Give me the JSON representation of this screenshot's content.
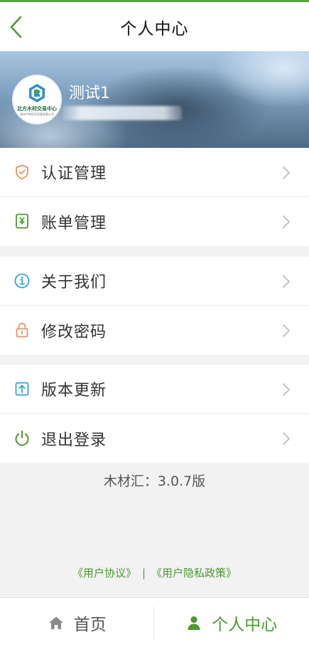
{
  "header": {
    "title": "个人中心",
    "back_icon": "chevron-left-icon"
  },
  "profile": {
    "username": "测试1",
    "avatar_logo_name": "北方木材交易中心",
    "avatar_logo_sub": "青岛中林投资发展有限公司"
  },
  "menu_group_1": [
    {
      "label": "认证管理",
      "icon": "shield-check-icon"
    },
    {
      "label": "账单管理",
      "icon": "bill-icon"
    }
  ],
  "menu_group_2": [
    {
      "label": "关于我们",
      "icon": "info-icon"
    },
    {
      "label": "修改密码",
      "icon": "lock-icon"
    }
  ],
  "menu_group_3": [
    {
      "label": "版本更新",
      "icon": "upload-icon"
    },
    {
      "label": "退出登录",
      "icon": "power-icon"
    }
  ],
  "version_text": "木材汇：3.0.7版",
  "links": {
    "user_agreement": "《用户协议》",
    "separator": "|",
    "privacy_policy": "《用户隐私政策》"
  },
  "tabbar": {
    "home_label": "首页",
    "profile_label": "个人中心"
  },
  "colors": {
    "accent": "#4b9a2e",
    "orange_icon": "#e8945a",
    "blue_icon": "#3aa0d8",
    "green_icon": "#4b9a2e"
  }
}
